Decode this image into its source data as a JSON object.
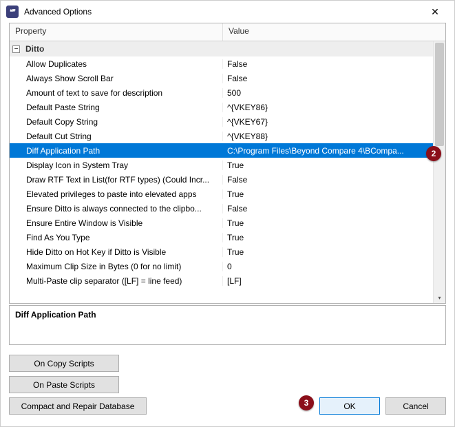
{
  "window": {
    "title": "Advanced Options",
    "close_glyph": "✕"
  },
  "grid": {
    "headers": {
      "property": "Property",
      "value": "Value"
    },
    "group": {
      "name": "Ditto",
      "toggle": "−"
    },
    "rows": [
      {
        "property": "Allow Duplicates",
        "value": "False"
      },
      {
        "property": "Always Show Scroll Bar",
        "value": "False"
      },
      {
        "property": "Amount of text to save for description",
        "value": "500"
      },
      {
        "property": "Default Paste String",
        "value": "^{VKEY86}"
      },
      {
        "property": "Default Copy String",
        "value": "^{VKEY67}"
      },
      {
        "property": "Default Cut String",
        "value": "^{VKEY88}"
      },
      {
        "property": "Diff Application Path",
        "value": "C:\\Program Files\\Beyond Compare 4\\BCompa..."
      },
      {
        "property": "Display Icon in System Tray",
        "value": "True"
      },
      {
        "property": "Draw RTF Text in List(for RTF types) (Could Incr...",
        "value": "False"
      },
      {
        "property": "Elevated privileges to paste into elevated apps",
        "value": "True"
      },
      {
        "property": "Ensure Ditto is always connected to the clipbo...",
        "value": "False"
      },
      {
        "property": "Ensure Entire Window is Visible",
        "value": "True"
      },
      {
        "property": "Find As You Type",
        "value": "True"
      },
      {
        "property": "Hide Ditto on Hot Key if Ditto is Visible",
        "value": "True"
      },
      {
        "property": "Maximum Clip Size in Bytes (0 for no limit)",
        "value": "0"
      },
      {
        "property": "Multi-Paste clip separator ([LF] = line feed)",
        "value": "[LF]"
      }
    ],
    "selected_index": 6
  },
  "description": {
    "title": "Diff Application Path"
  },
  "buttons": {
    "on_copy": "On Copy Scripts",
    "on_paste": "On Paste Scripts",
    "compact": "Compact and Repair Database",
    "ok": "OK",
    "cancel": "Cancel"
  },
  "annotations": {
    "badge2": "2",
    "badge3": "3"
  },
  "scroll": {
    "down_glyph": "▾"
  }
}
